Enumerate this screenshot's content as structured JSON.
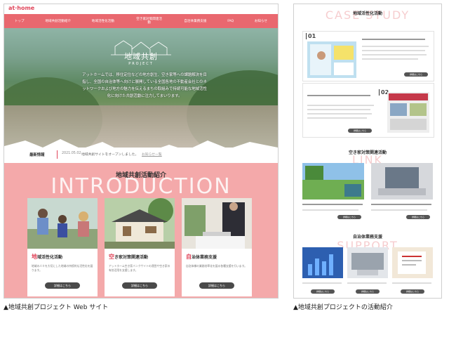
{
  "left_site": {
    "logo": "at·home",
    "nav": [
      "トップ",
      "地域共創活動紹介",
      "地域活性化活動",
      "空き家対策関連活動",
      "自治体業務支援",
      "FAQ",
      "お知らせ"
    ],
    "hero": {
      "title_jp": "地域共創",
      "title_en": "PROJECT",
      "text": "アットホームでは、移住定住などの地方創生、空き家等への課題解決を目指し、全国の自治体等へ向けに展開している全国各地の不動産会社とのネットワークおよび地方の魅力を伝えるまちの取組みで持続可能な地域活性化に向けた共創活動に注力してまいります。"
    },
    "news": {
      "label": "最新情報",
      "date": "2021.05.02",
      "text": "地域共創サイトをオープンしました。",
      "more": "お知らせ一覧"
    },
    "intro": {
      "title": "地域共創活動紹介",
      "bg_text": "INTRODUCTION",
      "cards": [
        {
          "first": "地",
          "rest": "域活性化活動",
          "desc": "地域の人々を大切にした地域の持続的な活性化を図ります。",
          "btn": "詳細はこちら"
        },
        {
          "first": "空",
          "rest": "き家対策関連活動",
          "desc": "アットホーム空き家バンクサイトの運営や空き家の有効活用を支援します。",
          "btn": "詳細はこちら"
        },
        {
          "first": "自",
          "rest": "治体業務支援",
          "desc": "自治体様の業務効率化を図る各種支援を行います。",
          "btn": "詳細はこちら"
        }
      ]
    },
    "caption": "▲地域共創プロジェクト Web サイト"
  },
  "right_site": {
    "section1": {
      "title": "地域活性化活動",
      "bg_text": "CASE STUDY",
      "num1": "01",
      "num2": "02",
      "btn": "詳細はこちら"
    },
    "section2": {
      "title": "空き家対策関連活動",
      "bg_text": "LINK",
      "btn": "詳細はこちら"
    },
    "section3": {
      "title": "自治体業務支援",
      "bg_text": "SUPPORT",
      "btn": "詳細はこちら"
    },
    "caption": "▲地域共創プロジェクトの活動紹介"
  },
  "colors": {
    "accent": "#e9686f",
    "pink": "#f4a9aa",
    "logo": "#e0455a"
  }
}
